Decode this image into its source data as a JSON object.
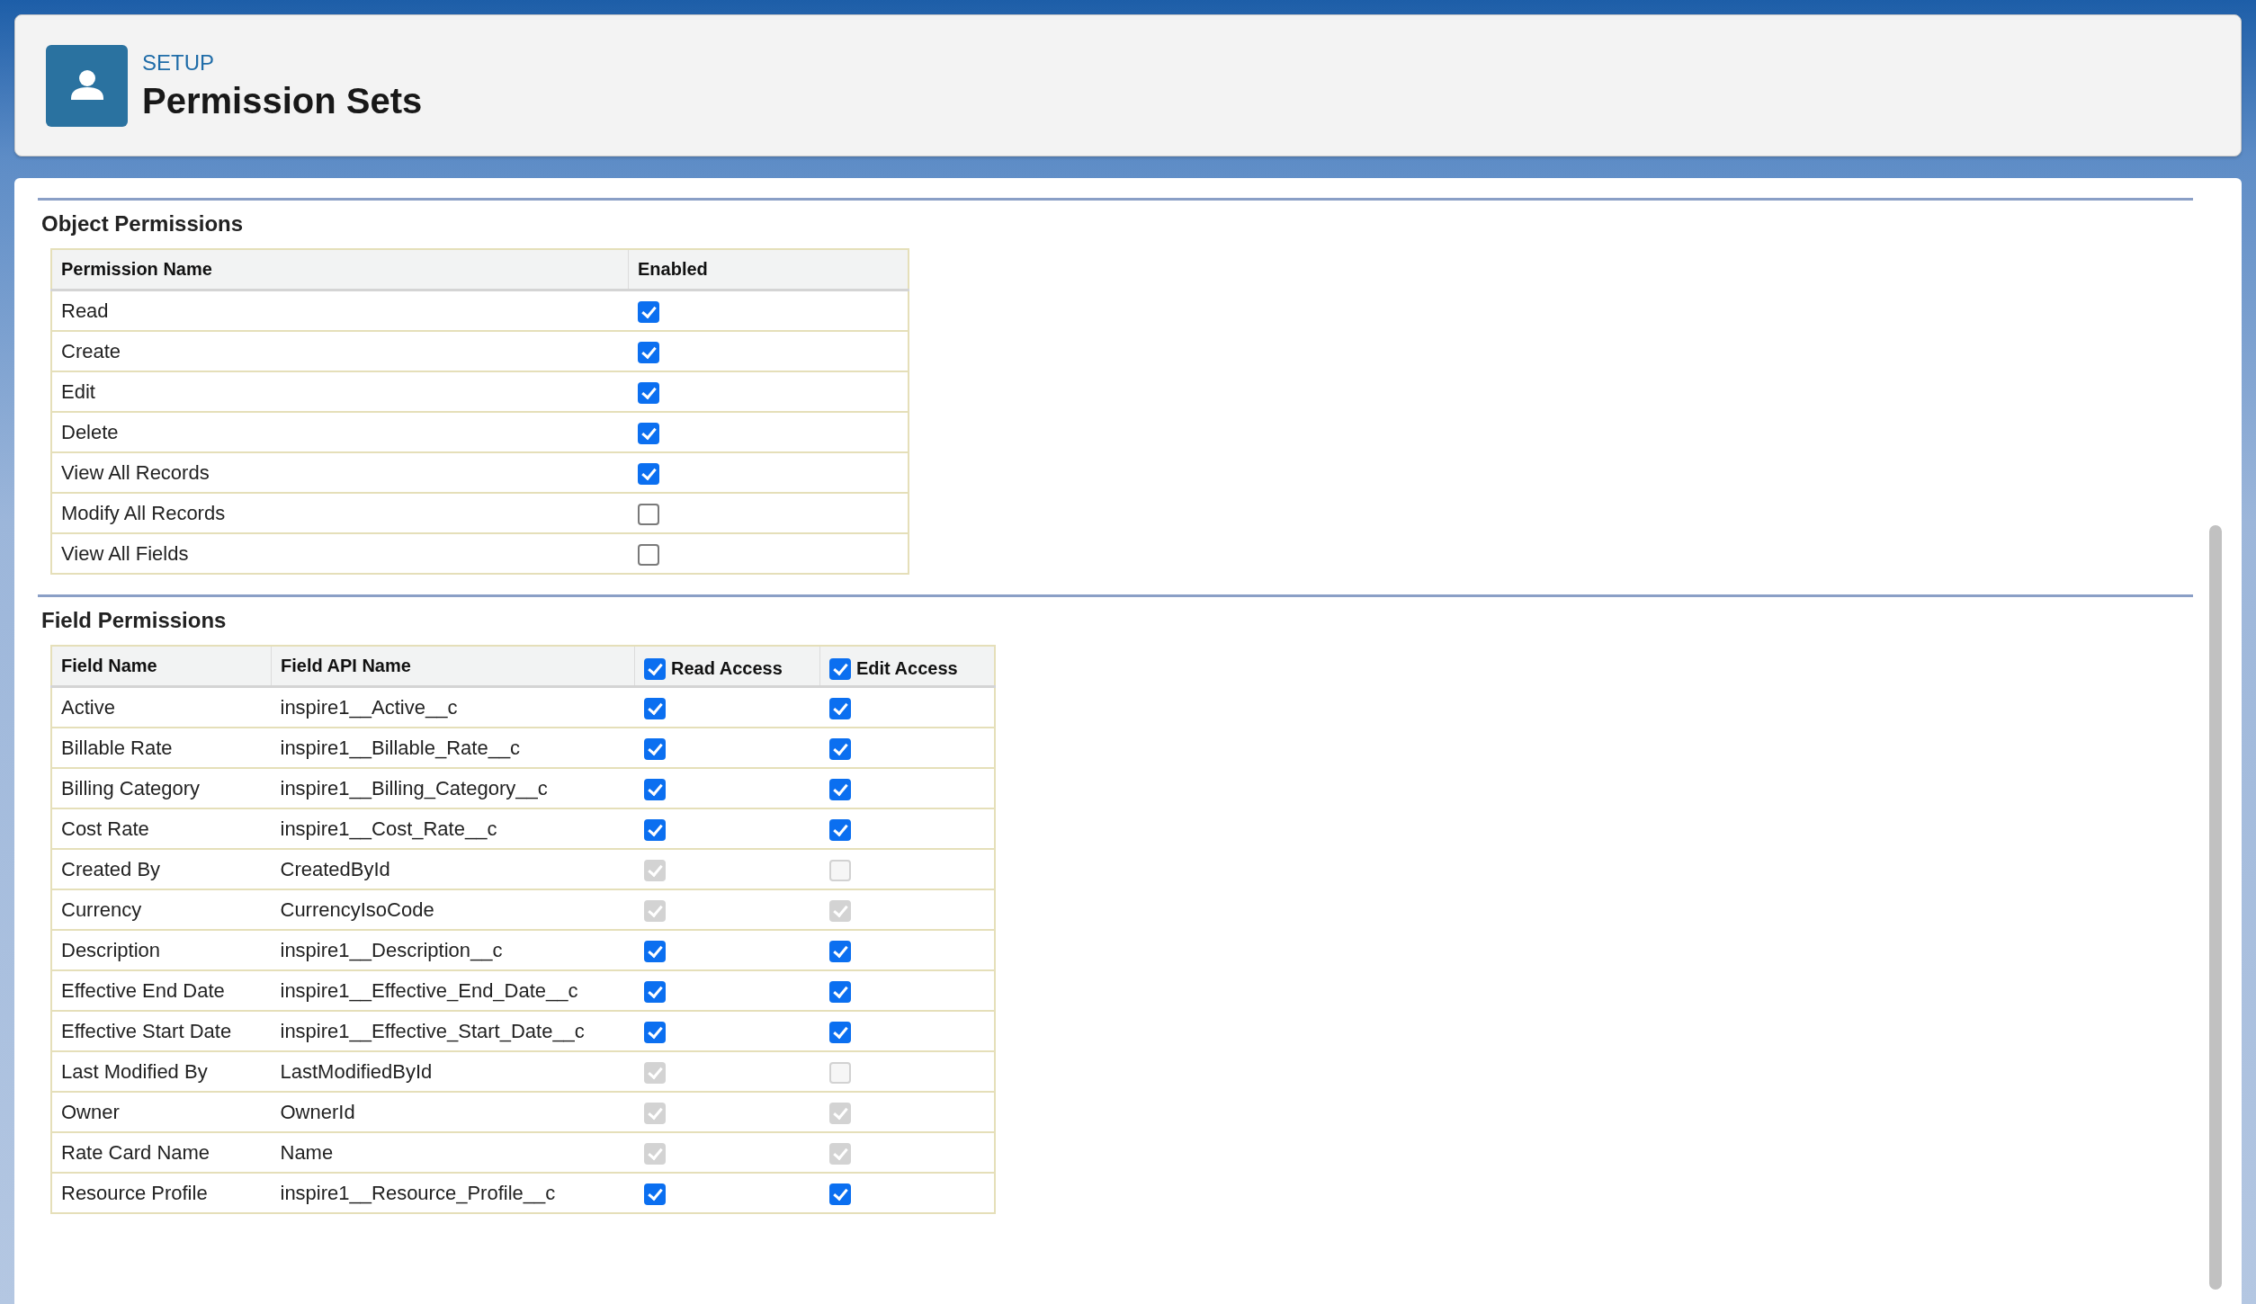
{
  "header": {
    "eyebrow": "SETUP",
    "title": "Permission Sets"
  },
  "object_permissions": {
    "title": "Object Permissions",
    "columns": [
      "Permission Name",
      "Enabled"
    ],
    "rows": [
      {
        "name": "Read",
        "enabled": {
          "checked": true,
          "disabled": false
        }
      },
      {
        "name": "Create",
        "enabled": {
          "checked": true,
          "disabled": false
        }
      },
      {
        "name": "Edit",
        "enabled": {
          "checked": true,
          "disabled": false
        }
      },
      {
        "name": "Delete",
        "enabled": {
          "checked": true,
          "disabled": false
        }
      },
      {
        "name": "View All Records",
        "enabled": {
          "checked": true,
          "disabled": false
        }
      },
      {
        "name": "Modify All Records",
        "enabled": {
          "checked": false,
          "disabled": false
        }
      },
      {
        "name": "View All Fields",
        "enabled": {
          "checked": false,
          "disabled": false
        }
      }
    ]
  },
  "field_permissions": {
    "title": "Field Permissions",
    "columns": [
      {
        "label": "Field Name"
      },
      {
        "label": "Field API Name"
      },
      {
        "label": "Read Access",
        "checked": true
      },
      {
        "label": "Edit Access",
        "checked": true
      }
    ],
    "rows": [
      {
        "field_name": "Active",
        "api_name": "inspire1__Active__c",
        "read": {
          "checked": true,
          "disabled": false
        },
        "edit": {
          "checked": true,
          "disabled": false
        }
      },
      {
        "field_name": "Billable Rate",
        "api_name": "inspire1__Billable_Rate__c",
        "read": {
          "checked": true,
          "disabled": false
        },
        "edit": {
          "checked": true,
          "disabled": false
        }
      },
      {
        "field_name": "Billing Category",
        "api_name": "inspire1__Billing_Category__c",
        "read": {
          "checked": true,
          "disabled": false
        },
        "edit": {
          "checked": true,
          "disabled": false
        }
      },
      {
        "field_name": "Cost Rate",
        "api_name": "inspire1__Cost_Rate__c",
        "read": {
          "checked": true,
          "disabled": false
        },
        "edit": {
          "checked": true,
          "disabled": false
        }
      },
      {
        "field_name": "Created By",
        "api_name": "CreatedById",
        "read": {
          "checked": true,
          "disabled": true
        },
        "edit": {
          "checked": false,
          "disabled": true
        }
      },
      {
        "field_name": "Currency",
        "api_name": "CurrencyIsoCode",
        "read": {
          "checked": true,
          "disabled": true
        },
        "edit": {
          "checked": true,
          "disabled": true
        }
      },
      {
        "field_name": "Description",
        "api_name": "inspire1__Description__c",
        "read": {
          "checked": true,
          "disabled": false
        },
        "edit": {
          "checked": true,
          "disabled": false
        }
      },
      {
        "field_name": "Effective End Date",
        "api_name": "inspire1__Effective_End_Date__c",
        "read": {
          "checked": true,
          "disabled": false
        },
        "edit": {
          "checked": true,
          "disabled": false
        }
      },
      {
        "field_name": "Effective Start Date",
        "api_name": "inspire1__Effective_Start_Date__c",
        "read": {
          "checked": true,
          "disabled": false
        },
        "edit": {
          "checked": true,
          "disabled": false
        }
      },
      {
        "field_name": "Last Modified By",
        "api_name": "LastModifiedById",
        "read": {
          "checked": true,
          "disabled": true
        },
        "edit": {
          "checked": false,
          "disabled": true
        }
      },
      {
        "field_name": "Owner",
        "api_name": "OwnerId",
        "read": {
          "checked": true,
          "disabled": true
        },
        "edit": {
          "checked": true,
          "disabled": true
        }
      },
      {
        "field_name": "Rate Card Name",
        "api_name": "Name",
        "read": {
          "checked": true,
          "disabled": true
        },
        "edit": {
          "checked": true,
          "disabled": true
        }
      },
      {
        "field_name": "Resource Profile",
        "api_name": "inspire1__Resource_Profile__c",
        "read": {
          "checked": true,
          "disabled": false
        },
        "edit": {
          "checked": true,
          "disabled": false
        }
      }
    ]
  }
}
